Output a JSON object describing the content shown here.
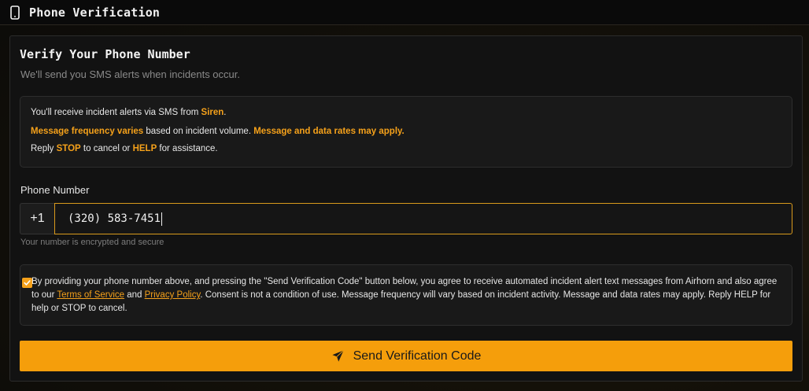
{
  "topbar": {
    "icon": "smartphone-icon",
    "title": "Phone Verification"
  },
  "card": {
    "title": "Verify Your Phone Number",
    "subtitle": "We'll send you SMS alerts when incidents occur."
  },
  "info": {
    "line1_pre": "You'll receive incident alerts via SMS from ",
    "line1_brand": "Siren",
    "line1_post": ".",
    "line2_hl1": "Message frequency varies",
    "line2_mid": " based on incident volume. ",
    "line2_hl2": "Message and data rates may apply.",
    "line3_pre": "Reply ",
    "line3_stop": "STOP",
    "line3_mid": " to cancel or ",
    "line3_help": "HELP",
    "line3_post": " for assistance."
  },
  "phone": {
    "label": "Phone Number",
    "prefix": "+1",
    "value": "(320) 583-7451",
    "helper": "Your number is encrypted and secure"
  },
  "consent": {
    "checked": true,
    "text_pre": "By providing your phone number above, and pressing the \"Send Verification Code\" button below, you agree to receive automated incident alert text messages from Airhorn and also agree to our ",
    "terms_link": "Terms of Service",
    "and": " and ",
    "privacy_link": "Privacy Policy",
    "text_post": ". Consent is not a condition of use. Message frequency will vary based on incident activity. Message and data rates may apply. Reply HELP for help or STOP to cancel."
  },
  "send_button": {
    "icon": "send-icon",
    "label": "Send Verification Code"
  },
  "colors": {
    "accent": "#f59e0b",
    "highlight": "#f5a11a",
    "background": "#121212"
  }
}
